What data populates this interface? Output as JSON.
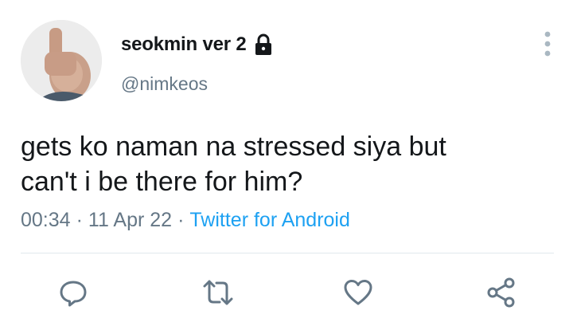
{
  "user": {
    "display_name": "seokmin ver 2",
    "handle": "@nimkeos"
  },
  "tweet": {
    "text": "gets ko naman na stressed siya but\ncan't i be there for him?",
    "time": "00:34",
    "date": "11 Apr 22",
    "separator": "·",
    "source": "Twitter for Android"
  },
  "actions": [
    "reply-icon",
    "retweet-icon",
    "like-icon",
    "share-icon"
  ],
  "colors": {
    "accent": "#1da1f2",
    "muted": "#657786",
    "icon": "#657786"
  }
}
